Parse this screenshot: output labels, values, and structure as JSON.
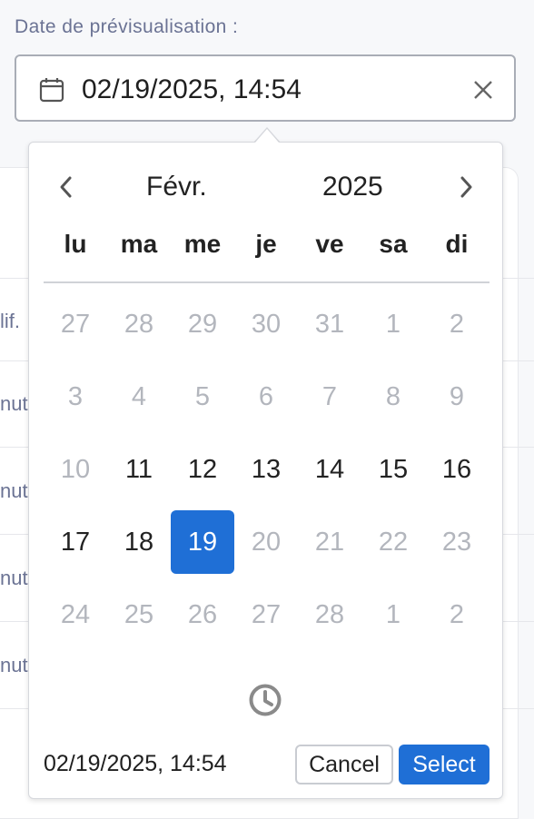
{
  "field": {
    "label": "Date de prévisualisation :",
    "value": "02/19/2025, 14:54"
  },
  "background": {
    "row_texts": [
      "lif.",
      "nut",
      "nut",
      "nut",
      "nut"
    ]
  },
  "picker": {
    "month": "Févr.",
    "year": "2025",
    "weekdays": [
      "lu",
      "ma",
      "me",
      "je",
      "ve",
      "sa",
      "di"
    ],
    "weeks": [
      [
        {
          "d": "27",
          "muted": true
        },
        {
          "d": "28",
          "muted": true
        },
        {
          "d": "29",
          "muted": true
        },
        {
          "d": "30",
          "muted": true
        },
        {
          "d": "31",
          "muted": true
        },
        {
          "d": "1",
          "muted": true
        },
        {
          "d": "2",
          "muted": true
        }
      ],
      [
        {
          "d": "3",
          "muted": true
        },
        {
          "d": "4",
          "muted": true
        },
        {
          "d": "5",
          "muted": true
        },
        {
          "d": "6",
          "muted": true
        },
        {
          "d": "7",
          "muted": true
        },
        {
          "d": "8",
          "muted": true
        },
        {
          "d": "9",
          "muted": true
        }
      ],
      [
        {
          "d": "10",
          "muted": true
        },
        {
          "d": "11",
          "muted": false
        },
        {
          "d": "12",
          "muted": false
        },
        {
          "d": "13",
          "muted": false
        },
        {
          "d": "14",
          "muted": false
        },
        {
          "d": "15",
          "muted": false
        },
        {
          "d": "16",
          "muted": false
        }
      ],
      [
        {
          "d": "17",
          "muted": false
        },
        {
          "d": "18",
          "muted": false
        },
        {
          "d": "19",
          "muted": false,
          "selected": true
        },
        {
          "d": "20",
          "muted": true
        },
        {
          "d": "21",
          "muted": true
        },
        {
          "d": "22",
          "muted": true
        },
        {
          "d": "23",
          "muted": true
        }
      ],
      [
        {
          "d": "24",
          "muted": true
        },
        {
          "d": "25",
          "muted": true
        },
        {
          "d": "26",
          "muted": true
        },
        {
          "d": "27",
          "muted": true
        },
        {
          "d": "28",
          "muted": true
        },
        {
          "d": "1",
          "muted": true
        },
        {
          "d": "2",
          "muted": true
        }
      ]
    ],
    "footer_value": "02/19/2025, 14:54",
    "cancel_label": "Cancel",
    "select_label": "Select"
  },
  "colors": {
    "accent": "#1f6fd6",
    "muted_day": "#b3b6bd",
    "label": "#6b7394"
  },
  "icons": {
    "field": "calendar-icon",
    "clear": "close-icon",
    "prev": "chevron-left-icon",
    "next": "chevron-right-icon",
    "time": "clock-icon"
  }
}
